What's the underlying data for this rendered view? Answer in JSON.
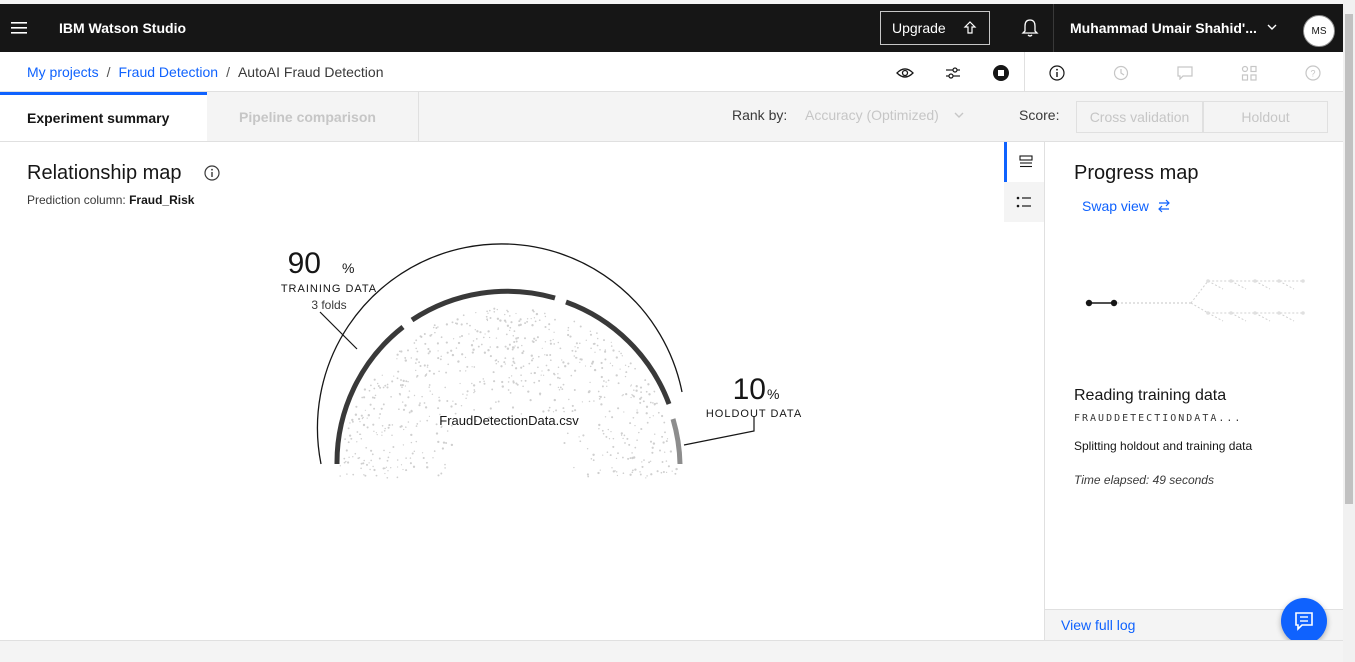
{
  "header": {
    "brand": "IBM Watson Studio",
    "upgrade_label": "Upgrade",
    "user_name": "Muhammad Umair Shahid'...",
    "avatar_initials": "MS"
  },
  "breadcrumb": {
    "items": [
      "My projects",
      "Fraud Detection"
    ],
    "separator": "/",
    "current": "AutoAI Fraud Detection"
  },
  "tabs": {
    "active": "Experiment summary",
    "inactive": "Pipeline comparison"
  },
  "rank": {
    "label": "Rank by:",
    "value": "Accuracy (Optimized)"
  },
  "score": {
    "label": "Score:",
    "cross_validation": "Cross validation",
    "holdout": "Holdout"
  },
  "relationship_map": {
    "title": "Relationship map",
    "prediction_label": "Prediction column:",
    "prediction_value": "Fraud_Risk",
    "training_pct": "90",
    "training_label": "TRAINING DATA",
    "training_folds": "3 folds",
    "holdout_pct": "10",
    "holdout_label": "HOLDOUT DATA",
    "pct_symbol": "%",
    "dataset": "FraudDetectionData.csv"
  },
  "progress_map": {
    "title": "Progress map",
    "swap_label": "Swap view",
    "status_title": "Reading training data",
    "file_name": "FRAUDDETECTIONDATA...",
    "step": "Splitting holdout and training data",
    "time_elapsed": "Time elapsed: 49 seconds",
    "view_log": "View full log"
  },
  "colors": {
    "accent": "#0f62fe",
    "header_bg": "#161616",
    "arc_dark": "#393939",
    "arc_holdout": "#8d8d8d"
  }
}
